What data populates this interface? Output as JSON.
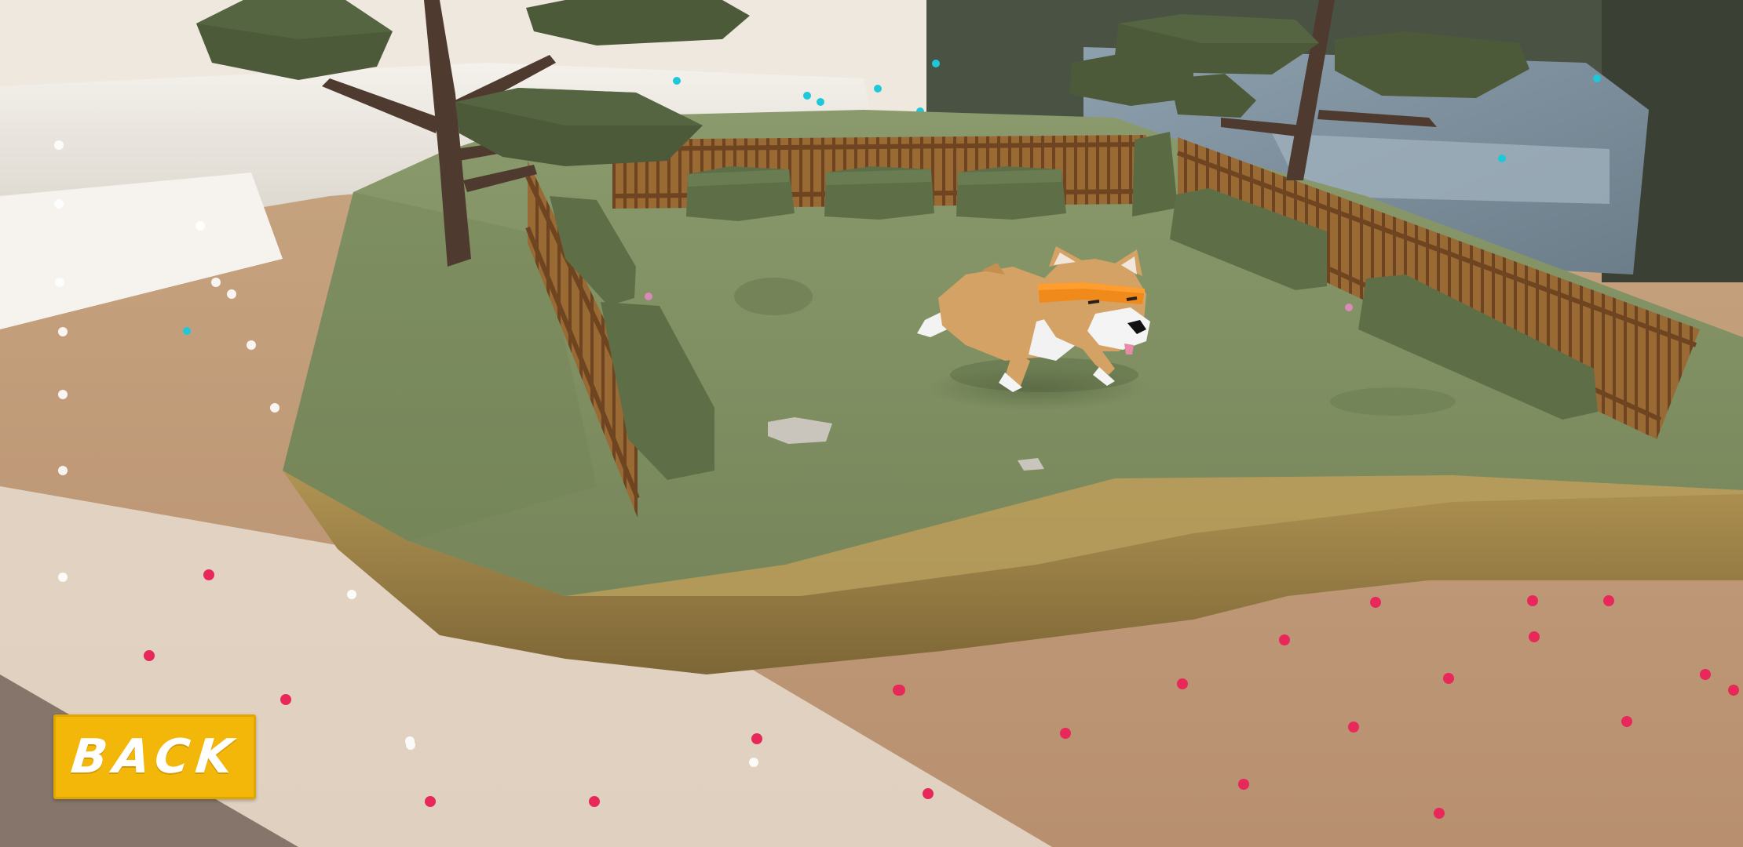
{
  "screen": {
    "type": "ar-game-view",
    "subject": "corgi"
  },
  "controls": {
    "back_label": "BACK"
  },
  "colors": {
    "back_button": "#f3b70a",
    "back_text": "#ffffff",
    "grass": "#7a8c5c",
    "dirt": "#a38848",
    "fence": "#8a5a2b",
    "hedge": "#5e6f47",
    "tree_trunk": "#4e3a2f",
    "tree_foliage": "#4c5a3a",
    "corgi_fur": "#d4a264",
    "headband": "#f08a1a",
    "ar_dots_red": "#e8285a",
    "ar_dots_white": "#ffffff",
    "ar_dots_cyan": "#1ec8d8"
  },
  "icons": {
    "scene": "corgi-playground",
    "tracking": "ar-plane-dots"
  }
}
